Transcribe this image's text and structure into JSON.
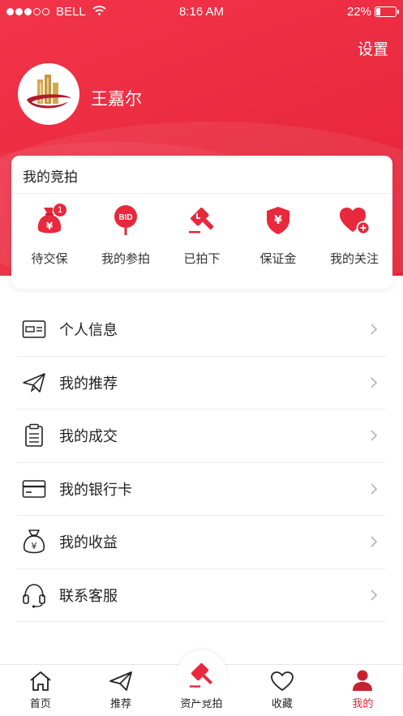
{
  "status_bar": {
    "carrier": "BELL",
    "time": "8:16 AM",
    "battery": "22%",
    "battery_level": 0.22
  },
  "header": {
    "settings_label": "设置",
    "username": "王嘉尔"
  },
  "auction": {
    "title": "我的竞拍",
    "items": [
      {
        "label": "待交保",
        "icon": "money-bag-icon",
        "badge": "1"
      },
      {
        "label": "我的参拍",
        "icon": "bid-sign-icon",
        "icon_text": "BID"
      },
      {
        "label": "已拍下",
        "icon": "gavel-icon"
      },
      {
        "label": "保证金",
        "icon": "shield-yen-icon",
        "icon_text": "¥"
      },
      {
        "label": "我的关注",
        "icon": "heart-plus-icon"
      }
    ]
  },
  "menu": [
    {
      "label": "个人信息",
      "icon": "id-card-icon"
    },
    {
      "label": "我的推荐",
      "icon": "paper-plane-icon"
    },
    {
      "label": "我的成交",
      "icon": "clipboard-icon"
    },
    {
      "label": "我的银行卡",
      "icon": "bank-card-icon"
    },
    {
      "label": "我的收益",
      "icon": "money-bag-icon"
    },
    {
      "label": "联系客服",
      "icon": "headset-icon"
    }
  ],
  "tabbar": [
    {
      "label": "首页",
      "icon": "home-icon"
    },
    {
      "label": "推荐",
      "icon": "paper-plane-icon"
    },
    {
      "label": "资产竞拍",
      "icon": "gavel-icon"
    },
    {
      "label": "收藏",
      "icon": "heart-icon"
    },
    {
      "label": "我的",
      "icon": "user-icon",
      "active": true
    }
  ],
  "colors": {
    "accent": "#e52438",
    "text": "#222222",
    "divider": "#ededed"
  }
}
